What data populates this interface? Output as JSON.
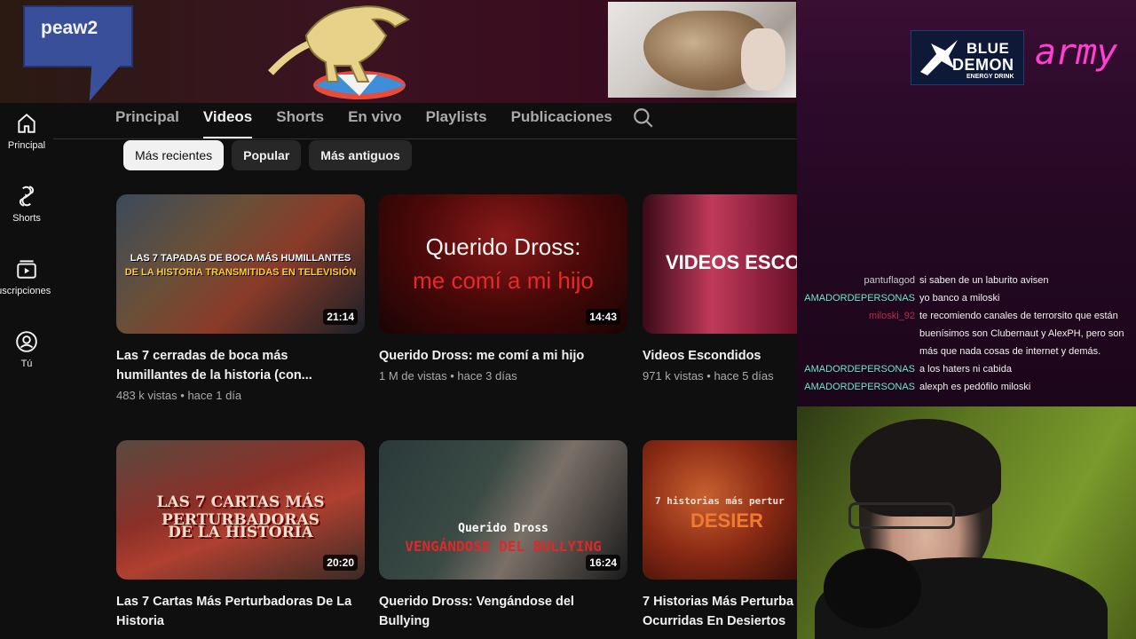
{
  "banner": {
    "bubble_text": "peaw2"
  },
  "sponsor": {
    "brand_line1": "BLUE",
    "brand_line2": "DEMON",
    "brand_line3": "ENERGY DRINK",
    "army_text": "army"
  },
  "chat": [
    {
      "user": "pantuflagod",
      "message": "si saben de un laburito avisen",
      "color": "#c9c9c9"
    },
    {
      "user": "AMADORDEPERSONAS",
      "message": "yo banco a miloski",
      "color": "#6ee8c8"
    },
    {
      "user": "miloski_92",
      "message": "te recomiendo canales de terrorsito que están buenísimos son Clubernaut y AlexPH, pero son más que nada cosas de internet y demás.",
      "color": "#c02a4a"
    },
    {
      "user": "AMADORDEPERSONAS",
      "message": "a los haters ni cabida",
      "color": "#6ee8c8"
    },
    {
      "user": "AMADORDEPERSONAS",
      "message": "alexph es pedófilo miloski",
      "color": "#6ee8c8"
    }
  ],
  "sidebar": {
    "items": [
      {
        "label": "Principal",
        "icon": "home-icon"
      },
      {
        "label": "Shorts",
        "icon": "shorts-icon"
      },
      {
        "label": "Suscripciones",
        "icon": "subscriptions-icon"
      },
      {
        "label": "Tú",
        "icon": "you-icon"
      }
    ]
  },
  "tabs": {
    "items": [
      "Principal",
      "Videos",
      "Shorts",
      "En vivo",
      "Playlists",
      "Publicaciones"
    ],
    "active": "Videos",
    "search_icon": "search-icon"
  },
  "chips": {
    "items": [
      "Más recientes",
      "Popular",
      "Más antiguos"
    ],
    "active": "Más recientes"
  },
  "videos": [
    {
      "title": "Las 7 cerradas de boca más humillantes de la historia (con...",
      "views": "483 k vistas",
      "age": "hace 1 día",
      "duration": "21:14",
      "thumb_line1": "LAS 7 TAPADAS DE BOCA MÁS HUMILLANTES",
      "thumb_line2": "DE LA HISTORIA TRANSMITIDAS EN TELEVISIÓN"
    },
    {
      "title": "Querido Dross: me comí a mi hijo",
      "views": "1 M de vistas",
      "age": "hace 3 días",
      "duration": "14:43",
      "thumb_line1": "Querido Dross:",
      "thumb_line2": "me comí a mi hijo"
    },
    {
      "title": "Videos Escondidos",
      "views": "971 k vistas",
      "age": "hace 5 días",
      "duration": "",
      "thumb_line1": "VIDEOS ESCO",
      "thumb_line2": ""
    },
    {
      "title": "Las 7 Cartas Más Perturbadoras De La Historia",
      "views": "",
      "age": "",
      "duration": "20:20",
      "thumb_line1": "LAS 7 CARTAS MÁS PERTURBADORAS",
      "thumb_line2": "DE LA HISTORIA"
    },
    {
      "title": "Querido Dross: Vengándose del Bullying",
      "views": "",
      "age": "",
      "duration": "16:24",
      "thumb_line1": "Querido Dross",
      "thumb_line2": "VENGÁNDOSE DEL BULLYING"
    },
    {
      "title": "7 Historias Más Perturba Ocurridas En Desiertos",
      "views": "",
      "age": "",
      "duration": "",
      "thumb_line1": "7 historias más pertur",
      "thumb_line2": "DESIER"
    }
  ]
}
